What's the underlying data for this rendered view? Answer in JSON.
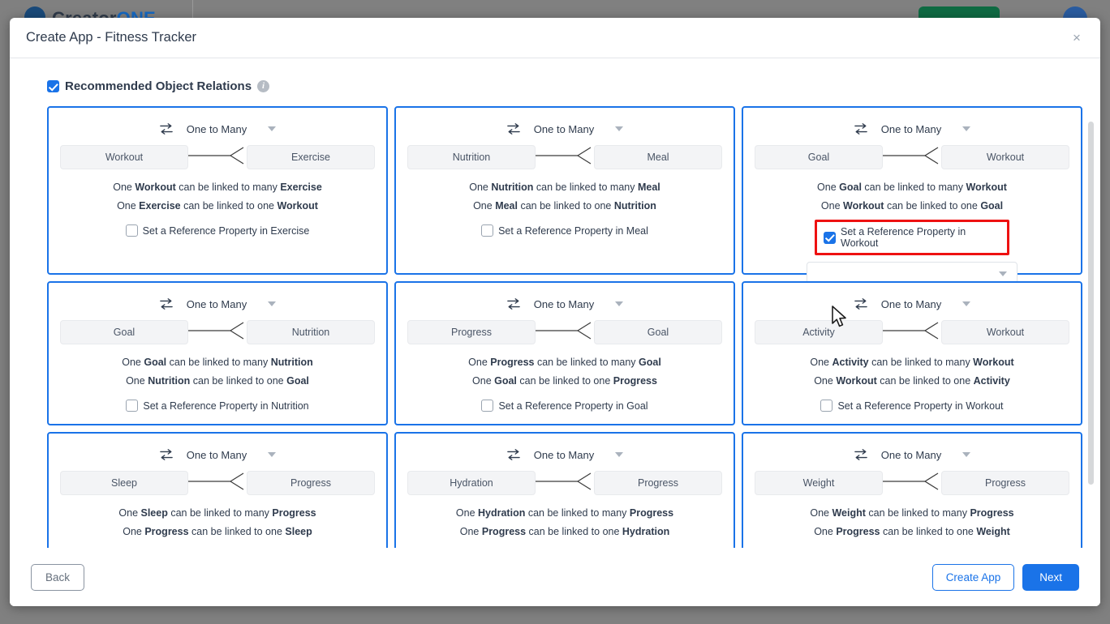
{
  "background": {
    "brand_primary": "Creator",
    "brand_accent": "ONE",
    "topbar_button_color": "#0f6b43",
    "avatar_color": "#2a5ca0"
  },
  "modal": {
    "title": "Create App - Fitness Tracker",
    "close_label": "×"
  },
  "section": {
    "checkbox_checked": true,
    "title": "Recommended Object Relations",
    "info_icon_label": "i"
  },
  "colors": {
    "accent": "#1a73e8",
    "card_border": "#1a73e8",
    "highlight": "#ee1111",
    "entity_box_bg": "#f3f4f6",
    "text": "#2f3b4d"
  },
  "relation_cards": [
    {
      "type": "One to Many",
      "left_entity": "Workout",
      "right_entity": "Exercise",
      "statement_one": "One Workout can be linked to many Exercise",
      "statement_two": "One Exercise can be linked to one Workout",
      "ref_label": "Set a Reference Property in Exercise",
      "ref_checked": false,
      "highlighted": false,
      "show_property_select": false,
      "property_select_value": ""
    },
    {
      "type": "One to Many",
      "left_entity": "Nutrition",
      "right_entity": "Meal",
      "statement_one": "One Nutrition can be linked to many Meal",
      "statement_two": "One Meal can be linked to one Nutrition",
      "ref_label": "Set a Reference Property in Meal",
      "ref_checked": false,
      "highlighted": false,
      "show_property_select": false,
      "property_select_value": ""
    },
    {
      "type": "One to Many",
      "left_entity": "Goal",
      "right_entity": "Workout",
      "statement_one": "One Goal can be linked to many Workout",
      "statement_two": "One Workout can be linked to one Goal",
      "ref_label": "Set a Reference Property in Workout",
      "ref_checked": true,
      "highlighted": true,
      "show_property_select": true,
      "property_select_value": ""
    },
    {
      "type": "One to Many",
      "left_entity": "Goal",
      "right_entity": "Nutrition",
      "statement_one": "One Goal can be linked to many Nutrition",
      "statement_two": "One Nutrition can be linked to one Goal",
      "ref_label": "Set a Reference Property in Nutrition",
      "ref_checked": false,
      "highlighted": false,
      "show_property_select": false,
      "property_select_value": ""
    },
    {
      "type": "One to Many",
      "left_entity": "Progress",
      "right_entity": "Goal",
      "statement_one": "One Progress can be linked to many Goal",
      "statement_two": "One Goal can be linked to one Progress",
      "ref_label": "Set a Reference Property in Goal",
      "ref_checked": false,
      "highlighted": false,
      "show_property_select": false,
      "property_select_value": ""
    },
    {
      "type": "One to Many",
      "left_entity": "Activity",
      "right_entity": "Workout",
      "statement_one": "One Activity can be linked to many Workout",
      "statement_two": "One Workout can be linked to one Activity",
      "ref_label": "Set a Reference Property in Workout",
      "ref_checked": false,
      "highlighted": false,
      "show_property_select": false,
      "property_select_value": ""
    },
    {
      "type": "One to Many",
      "left_entity": "Sleep",
      "right_entity": "Progress",
      "statement_one": "One Sleep can be linked to many Progress",
      "statement_two": "One Progress can be linked to one Sleep",
      "ref_label": "",
      "ref_checked": false,
      "highlighted": false,
      "show_property_select": false,
      "property_select_value": ""
    },
    {
      "type": "One to Many",
      "left_entity": "Hydration",
      "right_entity": "Progress",
      "statement_one": "One Hydration can be linked to many Progress",
      "statement_two": "One Progress can be linked to one Hydration",
      "ref_label": "",
      "ref_checked": false,
      "highlighted": false,
      "show_property_select": false,
      "property_select_value": ""
    },
    {
      "type": "One to Many",
      "left_entity": "Weight",
      "right_entity": "Progress",
      "statement_one": "One Weight can be linked to many Progress",
      "statement_two": "One Progress can be linked to one Weight",
      "ref_label": "",
      "ref_checked": false,
      "highlighted": false,
      "show_property_select": false,
      "property_select_value": ""
    }
  ],
  "footer": {
    "back_label": "Back",
    "create_app_label": "Create App",
    "next_label": "Next"
  }
}
